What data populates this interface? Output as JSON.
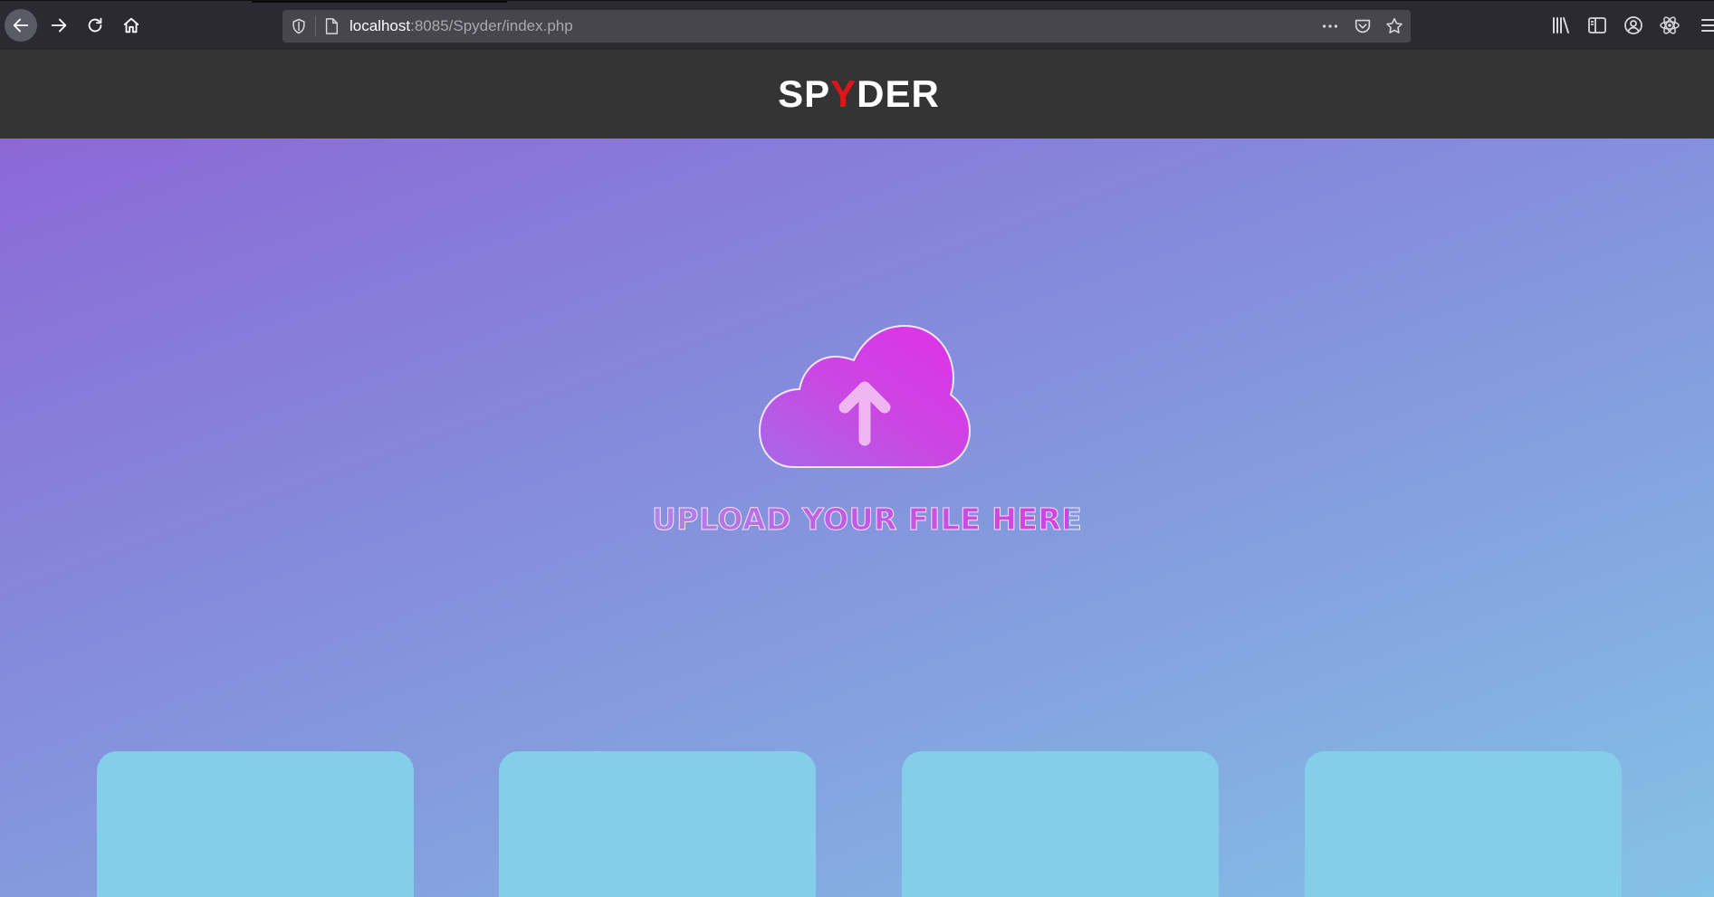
{
  "browser": {
    "url_host": "localhost",
    "url_rest": ":8085/Spyder/index.php"
  },
  "site": {
    "logo_prefix": "SP",
    "logo_accent": "Y",
    "logo_suffix": "DER",
    "accent_color": "#e0151b",
    "header_bg": "#343434"
  },
  "upload": {
    "label": "UPLOAD YOUR FILE HERE",
    "icon": "cloud-upload-icon"
  },
  "cards": [
    {
      "id": "card-1"
    },
    {
      "id": "card-2"
    },
    {
      "id": "card-3"
    },
    {
      "id": "card-4"
    }
  ]
}
